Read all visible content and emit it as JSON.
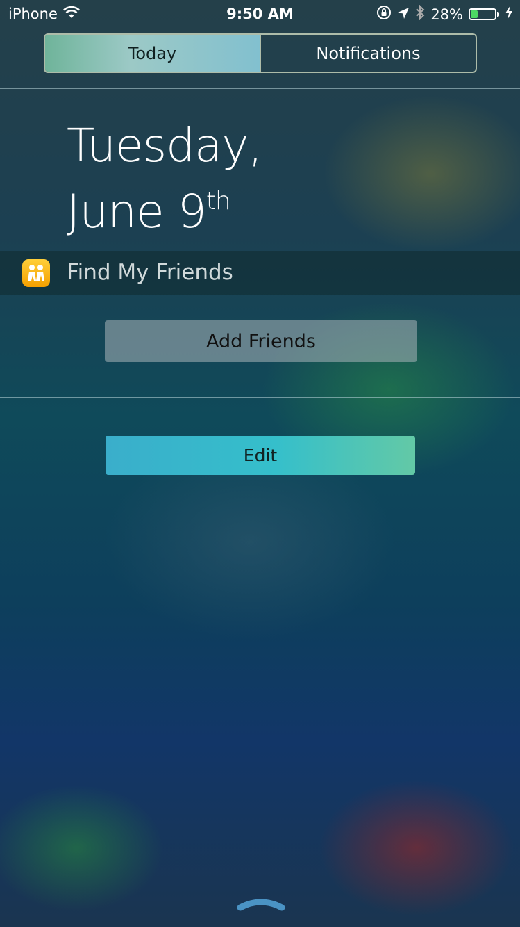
{
  "status_bar": {
    "carrier": "iPhone",
    "time": "9:50 AM",
    "battery_percent": "28%",
    "battery_level": 0.28,
    "icons": [
      "wifi-icon",
      "orientation-lock-icon",
      "location-arrow-icon",
      "bluetooth-icon",
      "battery-icon",
      "charging-bolt-icon"
    ]
  },
  "tabs": {
    "today": "Today",
    "notifications": "Notifications",
    "selected": "today"
  },
  "date": {
    "weekday": "Tuesday,",
    "month_day": "June 9",
    "ordinal_suffix": "th"
  },
  "widget": {
    "title": "Find My Friends",
    "icon": "find-my-friends-icon",
    "button_label": "Add Friends"
  },
  "edit_label": "Edit",
  "colors": {
    "accent_edit_start": "#3aaecb",
    "accent_edit_end": "#63c9a6",
    "battery_green": "#4cd964",
    "app_icon_yellow": "#ffcf3a"
  }
}
